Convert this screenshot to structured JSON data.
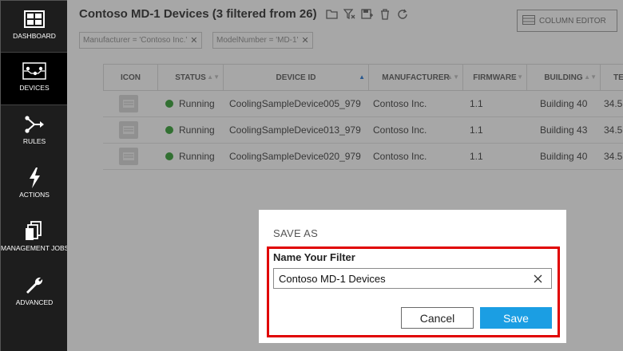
{
  "sidebar": {
    "items": [
      {
        "label": "DASHBOARD",
        "icon": "dashboard-icon",
        "active": false
      },
      {
        "label": "DEVICES",
        "icon": "devices-icon",
        "active": true
      },
      {
        "label": "RULES",
        "icon": "rules-icon",
        "active": false
      },
      {
        "label": "ACTIONS",
        "icon": "lightning-icon",
        "active": false
      },
      {
        "label": "MANAGEMENT JOBS",
        "icon": "jobs-icon",
        "active": false
      },
      {
        "label": "ADVANCED",
        "icon": "wrench-icon",
        "active": false
      }
    ]
  },
  "header": {
    "title": "Contoso MD-1 Devices (3 filtered from 26)",
    "toolbar_icons": [
      "open-folder-icon",
      "clear-filter-icon",
      "save-filter-icon",
      "delete-icon",
      "refresh-icon"
    ],
    "column_editor_label": "COLUMN EDITOR"
  },
  "filters": [
    {
      "label": "Manufacturer = 'Contoso Inc.'",
      "remove": "✕"
    },
    {
      "label": "ModelNumber = 'MD-1'",
      "remove": "✕"
    }
  ],
  "table": {
    "columns": [
      "ICON",
      "STATUS",
      "DEVICE ID",
      "MANUFACTURER",
      "FIRMWARE",
      "BUILDING",
      "TE"
    ],
    "sorted_column": "DEVICE ID",
    "rows": [
      {
        "status": "Running",
        "device_id": "CoolingSampleDevice005_979",
        "manufacturer": "Contoso Inc.",
        "firmware": "1.1",
        "building": "Building 40",
        "temp": "34.5"
      },
      {
        "status": "Running",
        "device_id": "CoolingSampleDevice013_979",
        "manufacturer": "Contoso Inc.",
        "firmware": "1.1",
        "building": "Building 43",
        "temp": "34.5"
      },
      {
        "status": "Running",
        "device_id": "CoolingSampleDevice020_979",
        "manufacturer": "Contoso Inc.",
        "firmware": "1.1",
        "building": "Building 40",
        "temp": "34.5"
      }
    ]
  },
  "dialog": {
    "title": "SAVE AS",
    "field_label": "Name Your Filter",
    "input_value": "Contoso MD-1 Devices",
    "cancel_label": "Cancel",
    "save_label": "Save"
  },
  "colors": {
    "sidebar_bg": "#1d1d1d",
    "accent": "#1b9ee3",
    "highlight": "#e00000",
    "status_running": "#2b9c2b"
  }
}
